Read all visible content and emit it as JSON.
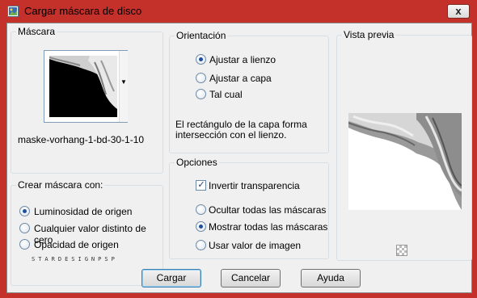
{
  "window": {
    "title": "Cargar máscara de disco",
    "close_label": "x"
  },
  "mascara": {
    "label": "Máscara",
    "selected_name": "maske-vorhang-1-bd-30-1-10"
  },
  "crear_mascara": {
    "label": "Crear máscara con:",
    "options": [
      {
        "label": "Luminosidad de origen",
        "selected": true
      },
      {
        "label": "Cualquier valor distinto de cero",
        "selected": false
      },
      {
        "label": "Opacidad de origen",
        "selected": false
      }
    ]
  },
  "orientacion": {
    "label": "Orientación",
    "options": [
      {
        "label": "Ajustar a lienzo",
        "selected": true
      },
      {
        "label": "Ajustar a capa",
        "selected": false
      },
      {
        "label": "Tal cual",
        "selected": false
      }
    ],
    "description": "El rectángulo de la capa forma intersección con el lienzo."
  },
  "opciones": {
    "label": "Opciones",
    "invert_label": "Invertir transparencia",
    "invert_checked": true,
    "options": [
      {
        "label": "Ocultar todas las máscaras",
        "selected": false
      },
      {
        "label": "Mostrar todas las máscaras",
        "selected": true
      },
      {
        "label": "Usar valor de imagen",
        "selected": false
      }
    ]
  },
  "vista_previa": {
    "label": "Vista previa"
  },
  "watermark": "STARDESIGNPSP",
  "buttons": {
    "cargar": "Cargar",
    "cancelar": "Cancelar",
    "ayuda": "Ayuda"
  },
  "colors": {
    "frame": "#c4302a",
    "dialog_bg": "#f0f0f0",
    "group_border": "#d5dfe5",
    "default_button_border": "#3c7fb1"
  },
  "icons": [
    "app-icon",
    "close-icon",
    "dropdown-arrow-icon",
    "checkerboard-icon"
  ]
}
